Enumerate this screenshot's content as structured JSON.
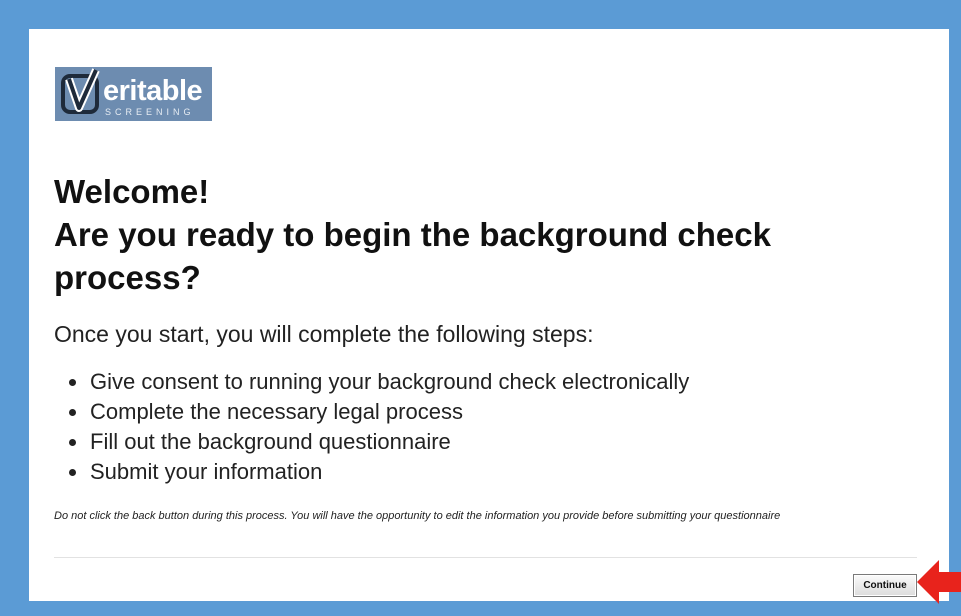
{
  "logo": {
    "word": "eritable",
    "sub": "SCREENING",
    "check_letter": "V"
  },
  "headline": {
    "line1": "Welcome!",
    "line2": "Are you ready to begin the background check",
    "line3": "process?"
  },
  "intro": "Once you start, you will complete the following steps:",
  "steps": [
    "Give consent to running your background check electronically",
    "Complete the necessary legal process",
    "Fill out the background questionnaire",
    "Submit your information"
  ],
  "warning": "Do not click the back button during this process. You will have the opportunity to edit the information you provide before submitting your questionnaire",
  "continue_label": "Continue",
  "colors": {
    "frame": "#5b9bd5",
    "logo_bg": "#6d8cb0",
    "arrow": "#e8231c"
  },
  "icons": {
    "arrow": "red-arrow-left-icon"
  }
}
